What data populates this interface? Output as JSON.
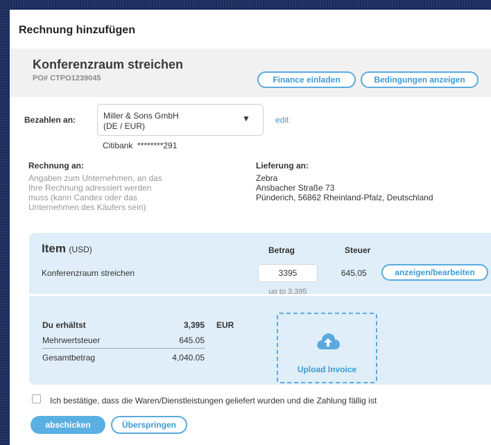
{
  "modal": {
    "title": "Rechnung hinzufügen"
  },
  "project": {
    "name": "Konferenzraum streichen",
    "po": "PO# CTPO1239045",
    "finance_button": "Finance einladen",
    "terms_button": "Bedingungen anzeigen"
  },
  "payto": {
    "label": "Bezahlen an:",
    "vendor_line1": "Miller & Sons GmbH",
    "vendor_line2": "(DE / EUR)",
    "arrow": "▼",
    "edit_link": "edit",
    "bank": "Citibank  ********291"
  },
  "invoice_to": {
    "label": "Rechnung an:",
    "hint_lines": [
      "Angaben zum Unternehmen, an das",
      "Ihre Rechnung adressiert werden",
      "muss (kann Candex oder das",
      "Unternehmen des Käufers sein)"
    ]
  },
  "delivery": {
    "label": "Lieferung an:",
    "lines": [
      "Zebra",
      "Ansbacher Straße 73",
      "Pünderich, 56862 Rheinland-Pfalz, Deutschland"
    ]
  },
  "items": {
    "header_item": "Item",
    "header_currency": "(USD)",
    "header_amount": "Betrag",
    "header_tax": "Steuer",
    "row_name": "Konferenzraum streichen",
    "row_amount": "3395",
    "row_limit": "up to 3,395",
    "row_tax": "645.05",
    "row_action": "anzeigen/bearbeiten"
  },
  "summary": {
    "receive_label": "Du erhältst",
    "receive_value": "3,395",
    "receive_currency": "EUR",
    "vat_label": "Mehrwertsteuer",
    "vat_value": "645.05",
    "total_label": "Gesamtbetrag",
    "total_value": "4,040.05"
  },
  "upload": {
    "label": "Upload Invoice",
    "icon": "cloud-upload-icon"
  },
  "confirm": {
    "text": "Ich bestätige, dass die Waren/Dienstleistungen geliefert wurden und die Zahlung fällig ist"
  },
  "actions": {
    "submit": "abschicken",
    "skip": "Überspringen"
  },
  "colors": {
    "accent": "#5aaadf",
    "panel": "#dfeef8",
    "backdrop": "#1c2b5c"
  }
}
